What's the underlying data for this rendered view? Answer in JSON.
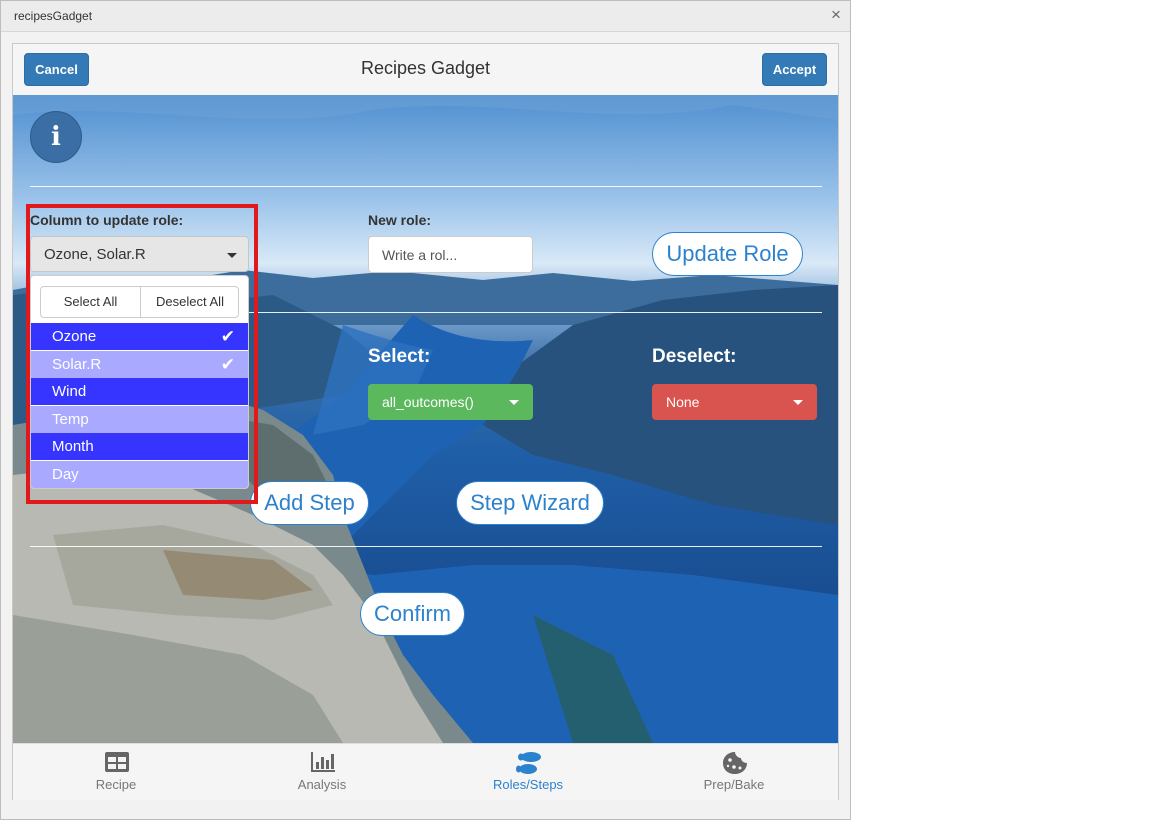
{
  "window": {
    "title": "recipesGadget",
    "close_label": "×"
  },
  "header": {
    "cancel_label": "Cancel",
    "title": "Recipes Gadget",
    "accept_label": "Accept"
  },
  "role_section": {
    "column_label": "Column to update role:",
    "column_selected": "Ozone, Solar.R",
    "new_role_label": "New role:",
    "new_role_placeholder": "Write a rol...",
    "new_role_value": "",
    "update_role_label": "Update Role"
  },
  "dropdown": {
    "select_all_label": "Select All",
    "deselect_all_label": "Deselect All",
    "options": [
      {
        "label": "Ozone",
        "checked": true
      },
      {
        "label": "Solar.R",
        "checked": true
      },
      {
        "label": "Wind",
        "checked": false
      },
      {
        "label": "Temp",
        "checked": false
      },
      {
        "label": "Month",
        "checked": false
      },
      {
        "label": "Day",
        "checked": false
      }
    ],
    "check_glyph": "✔"
  },
  "step_section": {
    "select_label": "Select:",
    "select_value": "all_outcomes()",
    "deselect_label": "Deselect:",
    "deselect_value": "None",
    "add_step_label": "Add Step",
    "step_wizard_label": "Step Wizard"
  },
  "confirm_label": "Confirm",
  "nav": {
    "items": [
      {
        "label": "Recipe",
        "icon": "table-icon"
      },
      {
        "label": "Analysis",
        "icon": "bar-chart-icon"
      },
      {
        "label": "Roles/Steps",
        "icon": "footsteps-icon",
        "active": true
      },
      {
        "label": "Prep/Bake",
        "icon": "cookie-icon"
      }
    ]
  },
  "colors": {
    "primary": "#337ab7",
    "success": "#5cb85c",
    "danger": "#d9534f",
    "selected_option_dark": "#3535ff",
    "selected_option_light": "#a9a9ff",
    "highlight_border": "#e0191d"
  }
}
